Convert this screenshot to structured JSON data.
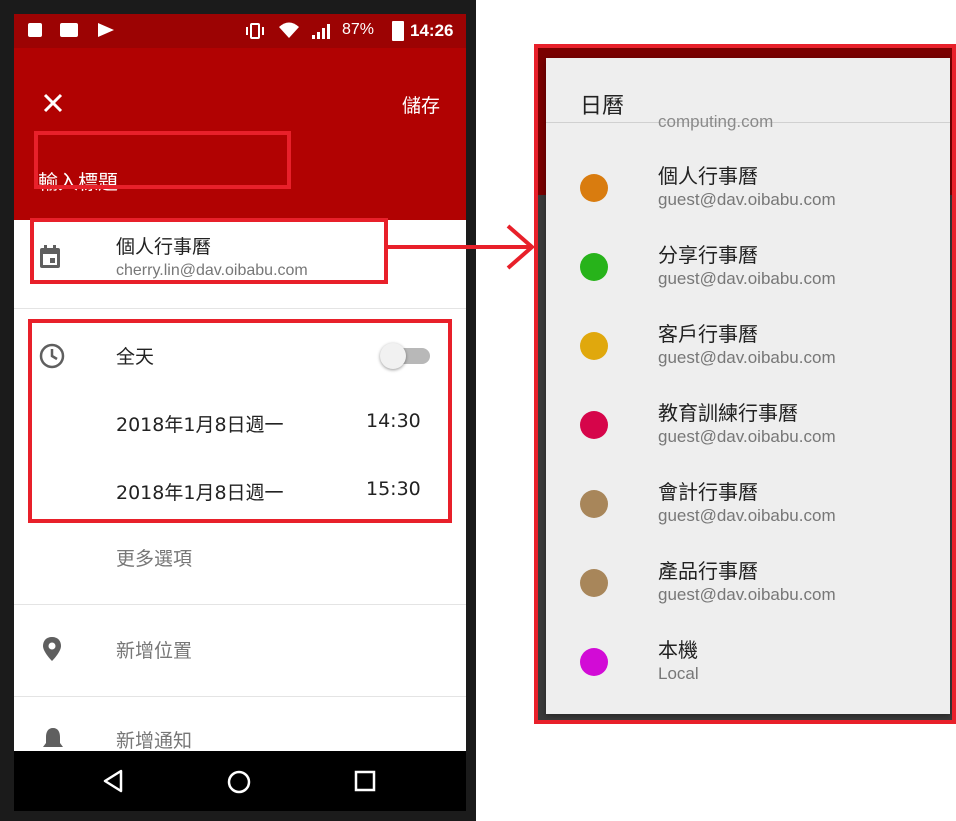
{
  "status_bar": {
    "battery": "87%",
    "time": "14:26"
  },
  "app_bar": {
    "save_label": "儲存",
    "title_placeholder": "輸入標題"
  },
  "calendar_row": {
    "name": "個人行事曆",
    "account": "cherry.lin@dav.oibabu.com"
  },
  "time_section": {
    "all_day_label": "全天",
    "start_date": "2018年1月8日週一",
    "start_time": "14:30",
    "end_date": "2018年1月8日週一",
    "end_time": "15:30"
  },
  "more_options": "更多選項",
  "add_location": "新增位置",
  "add_notification": "新增通知",
  "popup": {
    "title": "日曆",
    "partial_account": "computing.com",
    "items": [
      {
        "name": "個人行事曆",
        "account": "guest@dav.oibabu.com",
        "color": "#d97c0f"
      },
      {
        "name": "分享行事曆",
        "account": "guest@dav.oibabu.com",
        "color": "#27b31a"
      },
      {
        "name": "客戶行事曆",
        "account": "guest@dav.oibabu.com",
        "color": "#e0a80d"
      },
      {
        "name": "教育訓練行事曆",
        "account": "guest@dav.oibabu.com",
        "color": "#d6054a"
      },
      {
        "name": "會計行事曆",
        "account": "guest@dav.oibabu.com",
        "color": "#a8865a"
      },
      {
        "name": "產品行事曆",
        "account": "guest@dav.oibabu.com",
        "color": "#a8865a"
      },
      {
        "name": "本機",
        "account": "Local",
        "color": "#d20bd6"
      }
    ]
  },
  "colors": {
    "app_bar": "#b10202",
    "highlight": "#e8202a"
  }
}
